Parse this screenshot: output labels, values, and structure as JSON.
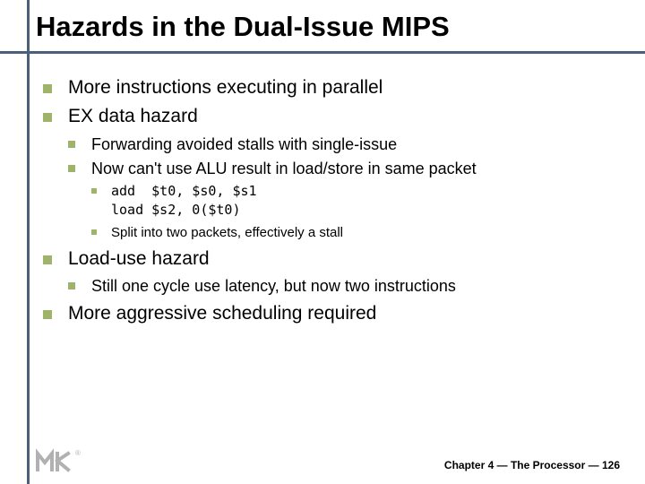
{
  "title": "Hazards in the Dual-Issue MIPS",
  "bullets": {
    "b1": "More instructions executing in parallel",
    "b2": "EX data hazard",
    "b2a": "Forwarding avoided stalls with single-issue",
    "b2b": "Now can't use ALU result in load/store in same packet",
    "b2b1": "add  $t0, $s0, $s1\nload $s2, 0($t0)",
    "b2b2": "Split into two packets, effectively a stall",
    "b3": "Load-use hazard",
    "b3a": "Still one cycle use latency, but now two instructions",
    "b4": "More aggressive scheduling required"
  },
  "footer": "Chapter 4 — The Processor — 126"
}
